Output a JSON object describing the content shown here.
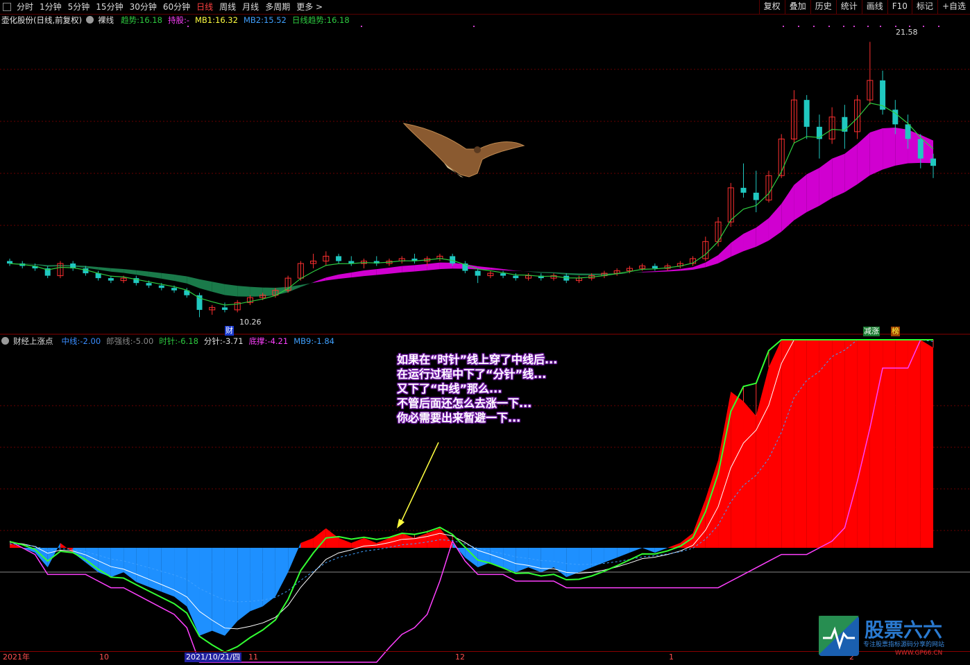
{
  "toolbar": {
    "periods": [
      "分时",
      "1分钟",
      "5分钟",
      "15分钟",
      "30分钟",
      "60分钟",
      "日线",
      "周线",
      "月线",
      "多周期",
      "更多 >"
    ],
    "active": "日线",
    "right_buttons": [
      "复权",
      "叠加",
      "历史",
      "统计",
      "画线",
      "F10",
      "标记",
      "+自选"
    ]
  },
  "main_info": {
    "stock": "壶化股份(日线,前复权)",
    "mode": "裸线",
    "items": [
      {
        "label": "趋势:",
        "value": "16.18",
        "color": "#2ecc40"
      },
      {
        "label": "持股:",
        "value": "-",
        "color": "#ff40ff"
      },
      {
        "label": "MB1:",
        "value": "16.32",
        "color": "#ffff40"
      },
      {
        "label": "MB2:",
        "value": "15.52",
        "color": "#3fa0ff"
      },
      {
        "label": "日线趋势:",
        "value": "16.18",
        "color": "#2ecc40"
      }
    ]
  },
  "sub_info": {
    "name": "财经上涨点",
    "items": [
      {
        "label": "中线:",
        "value": "-2.00",
        "color": "#3a8dff"
      },
      {
        "label": "郎强线:",
        "value": "-5.00",
        "color": "#888888"
      },
      {
        "label": "时针:",
        "value": "-6.18",
        "color": "#2ecc40"
      },
      {
        "label": "分针:",
        "value": "-3.71",
        "color": "#e0e0e0"
      },
      {
        "label": "底撑:",
        "value": "-4.21",
        "color": "#ff40ff"
      },
      {
        "label": "MB9:",
        "value": "-1.84",
        "color": "#3fa0ff"
      }
    ]
  },
  "labels": {
    "high_price": "21.58",
    "low_price": "10.26",
    "cai_marker": "财",
    "reduce_tag": "减涨",
    "bang_tag": "榜"
  },
  "annotation": {
    "lines": [
      "如果在“时针”线上穿了中线后...",
      "在运行过程中下了“分针”线...",
      "又下了“中线”那么...",
      "不管后面还怎么去涨一下...",
      "你必需要出来暂避一下..."
    ]
  },
  "dates": {
    "year": "2021年",
    "m10": "10",
    "selected": "2021/10/21/四",
    "m11": "11",
    "m12": "12",
    "m1": "1",
    "m2": "2"
  },
  "logo": {
    "title": "股票六六",
    "subtitle": "专注股票指标源码分享的网站",
    "url": "WWW.GP66.CN"
  },
  "colors": {
    "up": "#ff3030",
    "down": "#20c8c0",
    "trend": "#2ecc40",
    "band_up": "#d000d0",
    "band_down": "#1a7a4a",
    "fill_red": "#ff0000",
    "fill_blue": "#1e90ff"
  },
  "chart_data": {
    "type": "candlestick",
    "price_high": 21.58,
    "price_low": 10.26,
    "candles_ohlc": [
      [
        12.6,
        12.7,
        12.4,
        12.5
      ],
      [
        12.5,
        12.6,
        12.3,
        12.4
      ],
      [
        12.4,
        12.5,
        12.2,
        12.3
      ],
      [
        12.3,
        12.4,
        11.9,
        12.0
      ],
      [
        12.0,
        12.6,
        11.9,
        12.5
      ],
      [
        12.5,
        12.6,
        12.2,
        12.3
      ],
      [
        12.3,
        12.4,
        12.0,
        12.1
      ],
      [
        12.1,
        12.2,
        11.8,
        11.9
      ],
      [
        11.9,
        12.0,
        11.7,
        11.8
      ],
      [
        11.8,
        12.0,
        11.7,
        11.9
      ],
      [
        11.9,
        12.0,
        11.6,
        11.7
      ],
      [
        11.7,
        11.8,
        11.5,
        11.6
      ],
      [
        11.6,
        11.7,
        11.4,
        11.5
      ],
      [
        11.5,
        11.6,
        11.3,
        11.4
      ],
      [
        11.4,
        11.5,
        11.1,
        11.2
      ],
      [
        11.2,
        11.3,
        10.3,
        10.6
      ],
      [
        10.6,
        10.8,
        10.4,
        10.7
      ],
      [
        10.7,
        10.9,
        10.5,
        10.6
      ],
      [
        10.6,
        11.0,
        10.5,
        10.9
      ],
      [
        10.9,
        11.2,
        10.8,
        11.1
      ],
      [
        11.1,
        11.3,
        11.0,
        11.2
      ],
      [
        11.2,
        11.5,
        11.1,
        11.4
      ],
      [
        11.4,
        12.0,
        11.3,
        11.9
      ],
      [
        11.9,
        12.6,
        11.8,
        12.5
      ],
      [
        12.5,
        12.9,
        12.3,
        12.6
      ],
      [
        12.6,
        13.0,
        12.4,
        12.8
      ],
      [
        12.8,
        12.9,
        12.5,
        12.6
      ],
      [
        12.6,
        12.8,
        12.4,
        12.5
      ],
      [
        12.5,
        12.7,
        12.3,
        12.6
      ],
      [
        12.6,
        12.8,
        12.4,
        12.5
      ],
      [
        12.5,
        12.7,
        12.4,
        12.6
      ],
      [
        12.6,
        12.8,
        12.5,
        12.7
      ],
      [
        12.7,
        12.9,
        12.5,
        12.6
      ],
      [
        12.6,
        12.8,
        12.4,
        12.7
      ],
      [
        12.7,
        12.9,
        12.6,
        12.8
      ],
      [
        12.8,
        12.9,
        12.4,
        12.5
      ],
      [
        12.5,
        12.6,
        12.1,
        12.2
      ],
      [
        12.2,
        12.3,
        11.7,
        12.0
      ],
      [
        12.0,
        12.2,
        11.9,
        12.1
      ],
      [
        12.1,
        12.2,
        11.9,
        12.0
      ],
      [
        12.0,
        12.1,
        11.8,
        11.9
      ],
      [
        11.9,
        12.1,
        11.8,
        12.0
      ],
      [
        12.0,
        12.1,
        11.8,
        11.9
      ],
      [
        11.9,
        12.1,
        11.8,
        12.0
      ],
      [
        12.0,
        12.1,
        11.7,
        11.8
      ],
      [
        11.8,
        12.0,
        11.7,
        11.9
      ],
      [
        11.9,
        12.1,
        11.8,
        12.0
      ],
      [
        12.0,
        12.2,
        11.9,
        12.1
      ],
      [
        12.1,
        12.3,
        12.0,
        12.2
      ],
      [
        12.2,
        12.4,
        12.1,
        12.3
      ],
      [
        12.3,
        12.5,
        12.2,
        12.4
      ],
      [
        12.4,
        12.5,
        12.2,
        12.3
      ],
      [
        12.3,
        12.5,
        12.2,
        12.4
      ],
      [
        12.4,
        12.6,
        12.3,
        12.5
      ],
      [
        12.5,
        12.8,
        12.4,
        12.7
      ],
      [
        12.7,
        13.6,
        12.6,
        13.4
      ],
      [
        13.4,
        14.4,
        13.2,
        14.2
      ],
      [
        14.2,
        15.8,
        14.0,
        15.6
      ],
      [
        15.6,
        16.6,
        15.2,
        15.4
      ],
      [
        15.4,
        16.3,
        14.6,
        15.1
      ],
      [
        15.1,
        16.3,
        15.0,
        16.1
      ],
      [
        16.1,
        17.8,
        16.0,
        17.6
      ],
      [
        17.6,
        19.6,
        17.4,
        19.2
      ],
      [
        19.2,
        19.4,
        17.6,
        18.1
      ],
      [
        18.1,
        18.6,
        16.8,
        17.6
      ],
      [
        17.6,
        18.9,
        17.4,
        18.5
      ],
      [
        18.5,
        19.0,
        17.2,
        17.9
      ],
      [
        17.9,
        19.4,
        17.6,
        19.2
      ],
      [
        19.2,
        21.58,
        19.0,
        20.0
      ],
      [
        20.0,
        20.4,
        18.6,
        18.8
      ],
      [
        18.8,
        19.2,
        17.8,
        18.2
      ],
      [
        18.2,
        18.6,
        17.2,
        17.6
      ],
      [
        17.6,
        17.8,
        16.4,
        16.8
      ],
      [
        16.8,
        17.0,
        16.0,
        16.5
      ]
    ]
  }
}
